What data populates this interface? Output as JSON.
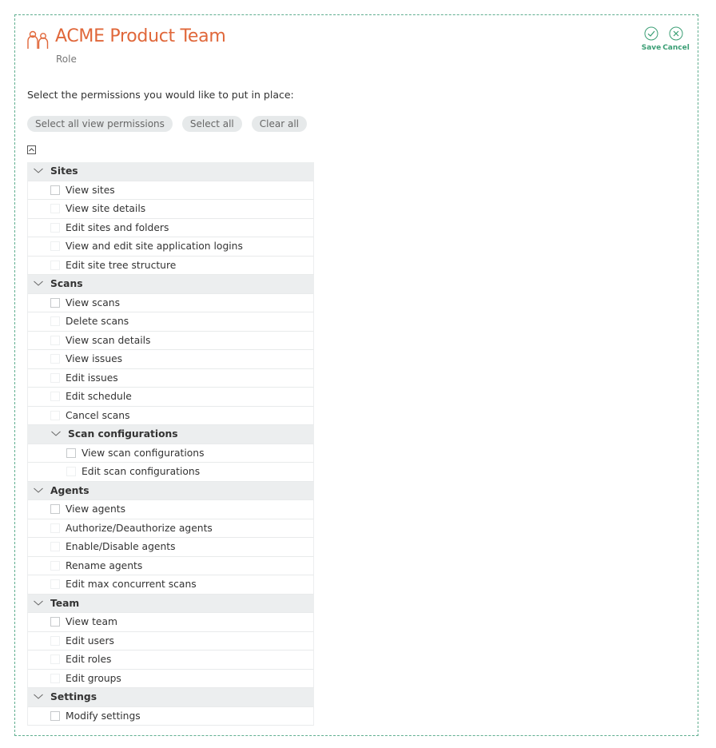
{
  "header": {
    "title": "ACME Product Team",
    "subtitle": "Role",
    "save_label": "Save",
    "cancel_label": "Cancel",
    "accent_color": "#e0673a",
    "action_color": "#3a9e74"
  },
  "intro_text": "Select the permissions you would like to put in place:",
  "bulk_actions": {
    "select_view": "Select all view permissions",
    "select_all": "Select all",
    "clear_all": "Clear all"
  },
  "groups": [
    {
      "title": "Sites",
      "items": [
        "View sites",
        "View site details",
        "Edit sites and folders",
        "View and edit site application logins",
        "Edit site tree structure"
      ]
    },
    {
      "title": "Scans",
      "items": [
        "View scans",
        "Delete scans",
        "View scan details",
        "View issues",
        "Edit issues",
        "Edit schedule",
        "Cancel scans"
      ],
      "subgroup": {
        "title": "Scan configurations",
        "items": [
          "View scan configurations",
          "Edit scan configurations"
        ]
      }
    },
    {
      "title": "Agents",
      "items": [
        "View agents",
        "Authorize/Deauthorize agents",
        "Enable/Disable agents",
        "Rename agents",
        "Edit max concurrent scans"
      ]
    },
    {
      "title": "Team",
      "items": [
        "View team",
        "Edit users",
        "Edit roles",
        "Edit groups"
      ]
    },
    {
      "title": "Settings",
      "items": [
        "Modify settings"
      ]
    }
  ]
}
